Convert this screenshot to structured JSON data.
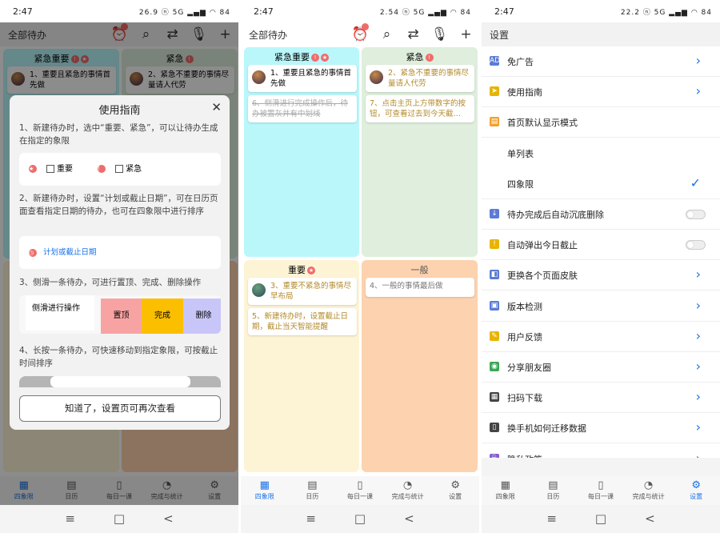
{
  "status": {
    "time": "2:47",
    "icons_p1": "26.9 ⓝ 5G ▂▄▆ ◠ 84",
    "icons_p2": "2.54 ⓝ 5G ▂▄▆ ◠ 84",
    "icons_p3": "22.2 ⓝ 5G ▂▄▆ ◠ 84"
  },
  "topbar": {
    "title": "全部待办"
  },
  "quadrants": {
    "q1": {
      "label": "紧急重要",
      "color": "#b9f7fb",
      "items": [
        {
          "text": "1、重要且紧急的事情首先做",
          "done": false,
          "avatar": true
        },
        {
          "text": "6、侧滑进行完成操作后，待办被置灰并有中划线",
          "done": true,
          "avatar": false
        }
      ]
    },
    "q2": {
      "label": "紧急",
      "color": "#dfeedd",
      "items": [
        {
          "text": "2、紧急不重要的事情尽量请人代劳",
          "done": false,
          "avatar": true
        },
        {
          "text": "7、点击主页上方带数字的按钮，可查看过去到今天截…",
          "done": false,
          "avatar": false
        }
      ]
    },
    "q3": {
      "label": "重要",
      "color": "#fdf4d6",
      "items": [
        {
          "text": "3、重要不紧急的事情尽早布局",
          "done": false,
          "avatar": true
        },
        {
          "text": "5、新建待办时，设置截止日期，截止当天智能提醒",
          "done": false,
          "avatar": false
        }
      ]
    },
    "q4": {
      "label": "一般",
      "color": "#fdd2ae",
      "items": [
        {
          "text": "4、一般的事情最后做",
          "done": false,
          "avatar": false
        }
      ]
    }
  },
  "tabs": [
    "四象限",
    "日历",
    "每日一课",
    "完成与统计",
    "设置"
  ],
  "dialog": {
    "title": "使用指南",
    "step1": "1、新建待办时，选中“重要、紧急”，可以让待办生成在指定的象限",
    "chk_important": "重要",
    "chk_urgent": "紧急",
    "step2": "2、新建待办时，设置“计划或截止日期”，可在日历页面查看指定日期的待办，也可在四象限中进行排序",
    "date_label": "计划或截止日期",
    "step3": "3、侧滑一条待办，可进行置顶、完成、删除操作",
    "swipe_label": "侧滑进行操作",
    "swipe_top": "置顶",
    "swipe_done": "完成",
    "swipe_delete": "删除",
    "step4": "4、长按一条待办，可快速移动到指定象限，可按截止时间排序",
    "button": "知道了，设置页可再次查看"
  },
  "settings": {
    "title": "设置",
    "rows": [
      {
        "label": "免广告",
        "icon": "ad-icon",
        "color": "#5b7bd5",
        "kind": "chevron"
      },
      {
        "label": "使用指南",
        "icon": "compass-icon",
        "color": "#e8b400",
        "kind": "chevron"
      },
      {
        "label": "首页默认显示模式",
        "icon": "layout-icon",
        "color": "#f0a030",
        "kind": "none"
      },
      {
        "label": "单列表",
        "icon": "",
        "color": "",
        "kind": "none"
      },
      {
        "label": "四象限",
        "icon": "",
        "color": "",
        "kind": "check"
      },
      {
        "label": "待办完成后自动沉底删除",
        "icon": "arrow-down-icon",
        "color": "#5b7bd5",
        "kind": "toggle"
      },
      {
        "label": "自动弹出今日截止",
        "icon": "warning-icon",
        "color": "#e8b400",
        "kind": "toggle"
      },
      {
        "label": "更换各个页面皮肤",
        "icon": "skin-icon",
        "color": "#5b7bd5",
        "kind": "chevron"
      },
      {
        "label": "版本检测",
        "icon": "version-icon",
        "color": "#5b7bd5",
        "kind": "chevron"
      },
      {
        "label": "用户反馈",
        "icon": "feedback-icon",
        "color": "#e8b400",
        "kind": "chevron"
      },
      {
        "label": "分享朋友圈",
        "icon": "share-icon",
        "color": "#3aa757",
        "kind": "chevron"
      },
      {
        "label": "扫码下载",
        "icon": "qrcode-icon",
        "color": "#444444",
        "kind": "chevron"
      },
      {
        "label": "换手机如何迁移数据",
        "icon": "phone-icon",
        "color": "#444444",
        "kind": "chevron"
      },
      {
        "label": "隐私政策",
        "icon": "lock-icon",
        "color": "#8a5bd5",
        "kind": "chevron"
      }
    ]
  },
  "nav": {
    "menu": "≡",
    "home": "□",
    "back": "<"
  }
}
